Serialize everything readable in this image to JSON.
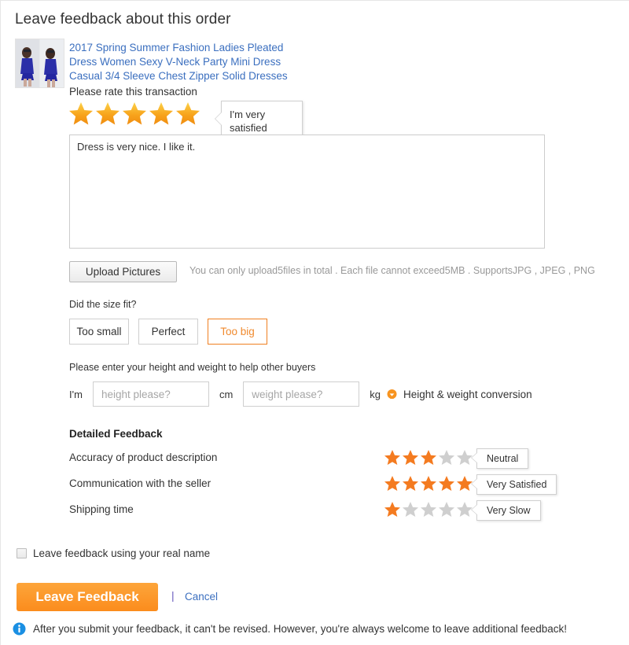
{
  "page": {
    "title": "Leave feedback about this order"
  },
  "product": {
    "title": "2017 Spring Summer Fashion Ladies Pleated Dress Women Sexy V-Neck Party Mini Dress Casual 3/4 Sleeve Chest Zipper Solid Dresses",
    "thumbnail_icon": "product-thumbnail-image"
  },
  "transaction_rating": {
    "label": "Please rate this transaction",
    "value": 5,
    "max": 5,
    "callout": "I'm very satisfied"
  },
  "comment": {
    "value": "Dress is very nice. I like it.",
    "placeholder": ""
  },
  "upload": {
    "button_label": "Upload Pictures",
    "hint": "You can only upload5files in total . Each file cannot exceed5MB . SupportsJPG , JPEG , PNG"
  },
  "size_fit": {
    "question": "Did the size fit?",
    "options": [
      {
        "label": "Too small",
        "selected": false
      },
      {
        "label": "Perfect",
        "selected": false
      },
      {
        "label": "Too big",
        "selected": true
      }
    ]
  },
  "height_weight": {
    "label": "Please enter your height and weight to help other buyers",
    "prefix": "I'm",
    "height_placeholder": "height please?",
    "height_value": "",
    "height_unit": "cm",
    "weight_placeholder": "weight please?",
    "weight_value": "",
    "weight_unit": "kg",
    "conversion_link": "Height & weight conversion",
    "bulb_icon": "lightbulb-icon"
  },
  "detailed_feedback": {
    "title": "Detailed Feedback",
    "rows": [
      {
        "name": "Accuracy of product description",
        "value": 3,
        "max": 5,
        "callout": "Neutral"
      },
      {
        "name": "Communication with the seller",
        "value": 5,
        "max": 5,
        "callout": "Very Satisfied"
      },
      {
        "name": "Shipping time",
        "value": 1,
        "max": 5,
        "callout": "Very Slow"
      }
    ]
  },
  "real_name": {
    "label": "Leave feedback using your real name",
    "checked": false
  },
  "actions": {
    "submit_label": "Leave Feedback",
    "separator": "|",
    "cancel_label": "Cancel"
  },
  "footer": {
    "info_icon": "info-icon",
    "note": "After you submit your feedback, it can't be revised. However, you're always welcome to leave additional feedback!"
  },
  "colors": {
    "accent_orange": "#fb8c1d",
    "star_gold": "#f5a623",
    "star_small_on": "#f47b20",
    "star_off": "#cccccc",
    "link_blue": "#3b6fbf",
    "info_blue": "#1a8fe3",
    "selected_border": "#f08020",
    "muted_text": "#999999"
  }
}
